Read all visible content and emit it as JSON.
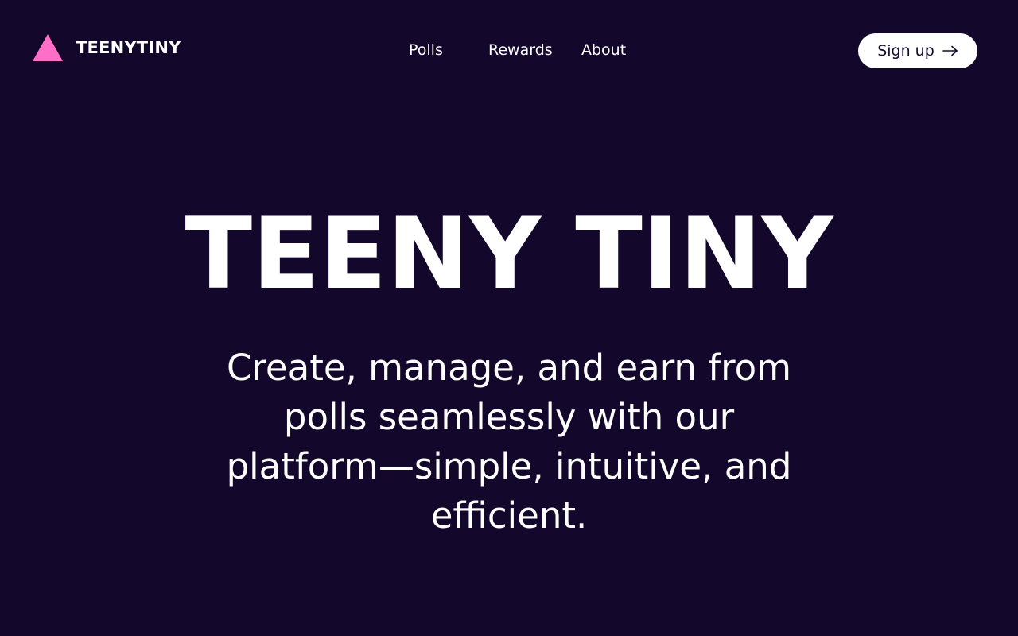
{
  "header": {
    "brand_name": "TEENYTINY",
    "logo_icon": "triangle-logo-icon",
    "nav": {
      "polls": "Polls",
      "rewards": "Rewards",
      "about": "About"
    },
    "signup_label": "Sign up",
    "signup_icon": "arrow-right-icon"
  },
  "hero": {
    "title": "TEENY TINY",
    "subtitle": "Create, manage, and earn from polls seamlessly with our platform—simple, intuitive, and efficient."
  },
  "colors": {
    "background": "#13082b",
    "accent_pink": "#ff6ec7",
    "text": "#ffffff",
    "button_bg": "#ffffff",
    "button_text": "#13082b"
  }
}
